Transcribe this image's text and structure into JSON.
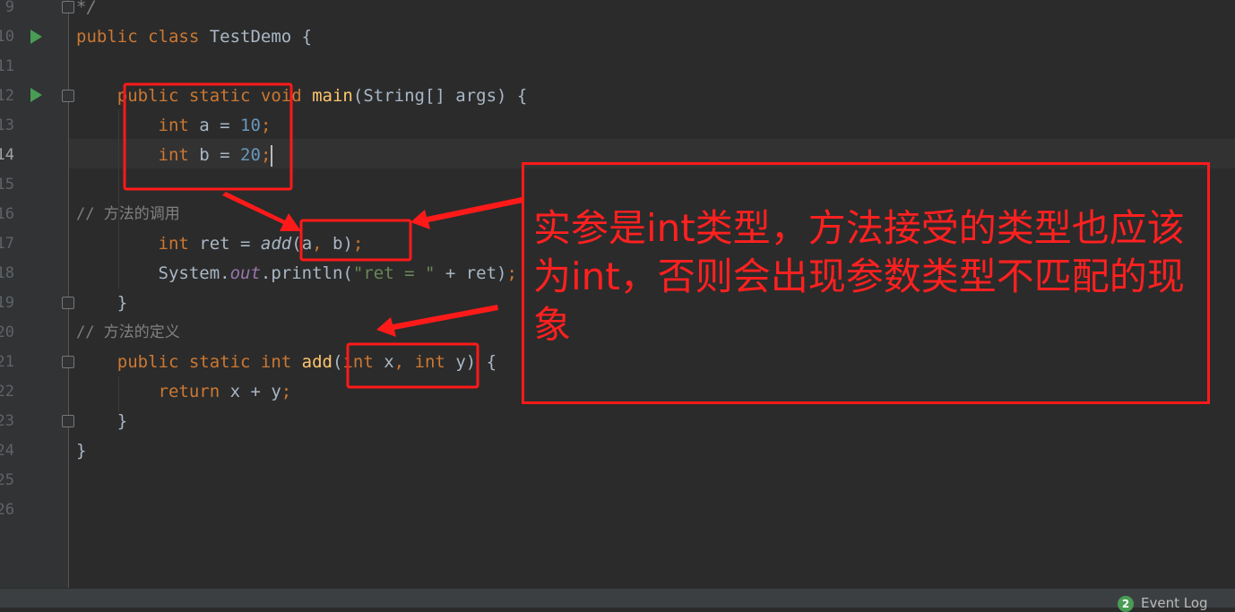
{
  "editor": {
    "current_line": 14,
    "lines": [
      {
        "n": "9",
        "text": "*/"
      },
      {
        "n": "10",
        "text": "public class TestDemo {"
      },
      {
        "n": "11",
        "text": ""
      },
      {
        "n": "12",
        "text": "public static void main(String[] args) {"
      },
      {
        "n": "13",
        "text": "int a = 10;"
      },
      {
        "n": "14",
        "text": "int b = 20;"
      },
      {
        "n": "15",
        "text": ""
      },
      {
        "n": "16",
        "text": "// 方法的调用"
      },
      {
        "n": "17",
        "text": "int ret = add(a, b);"
      },
      {
        "n": "18",
        "text": "System.out.println(\"ret = \" + ret);"
      },
      {
        "n": "19",
        "text": "}"
      },
      {
        "n": "20",
        "text": "// 方法的定义"
      },
      {
        "n": "21",
        "text": "public static int add(int x, int y) {"
      },
      {
        "n": "22",
        "text": "return x + y;"
      },
      {
        "n": "23",
        "text": "}"
      },
      {
        "n": "24",
        "text": "}"
      },
      {
        "n": "25",
        "text": ""
      },
      {
        "n": "26",
        "text": ""
      }
    ]
  },
  "annotation": {
    "note": "实参是int类型，方法接受的类型也应该为int，否则会出现参数类型不匹配的现象",
    "color": "#ff1a1a"
  },
  "statusbar": {
    "event_count": "2",
    "event_log": "Event Log"
  },
  "colors": {
    "keyword": "#cc7832",
    "number": "#6897bb",
    "string": "#6a8759",
    "function": "#ffc66d",
    "background": "#2b2b2b"
  }
}
